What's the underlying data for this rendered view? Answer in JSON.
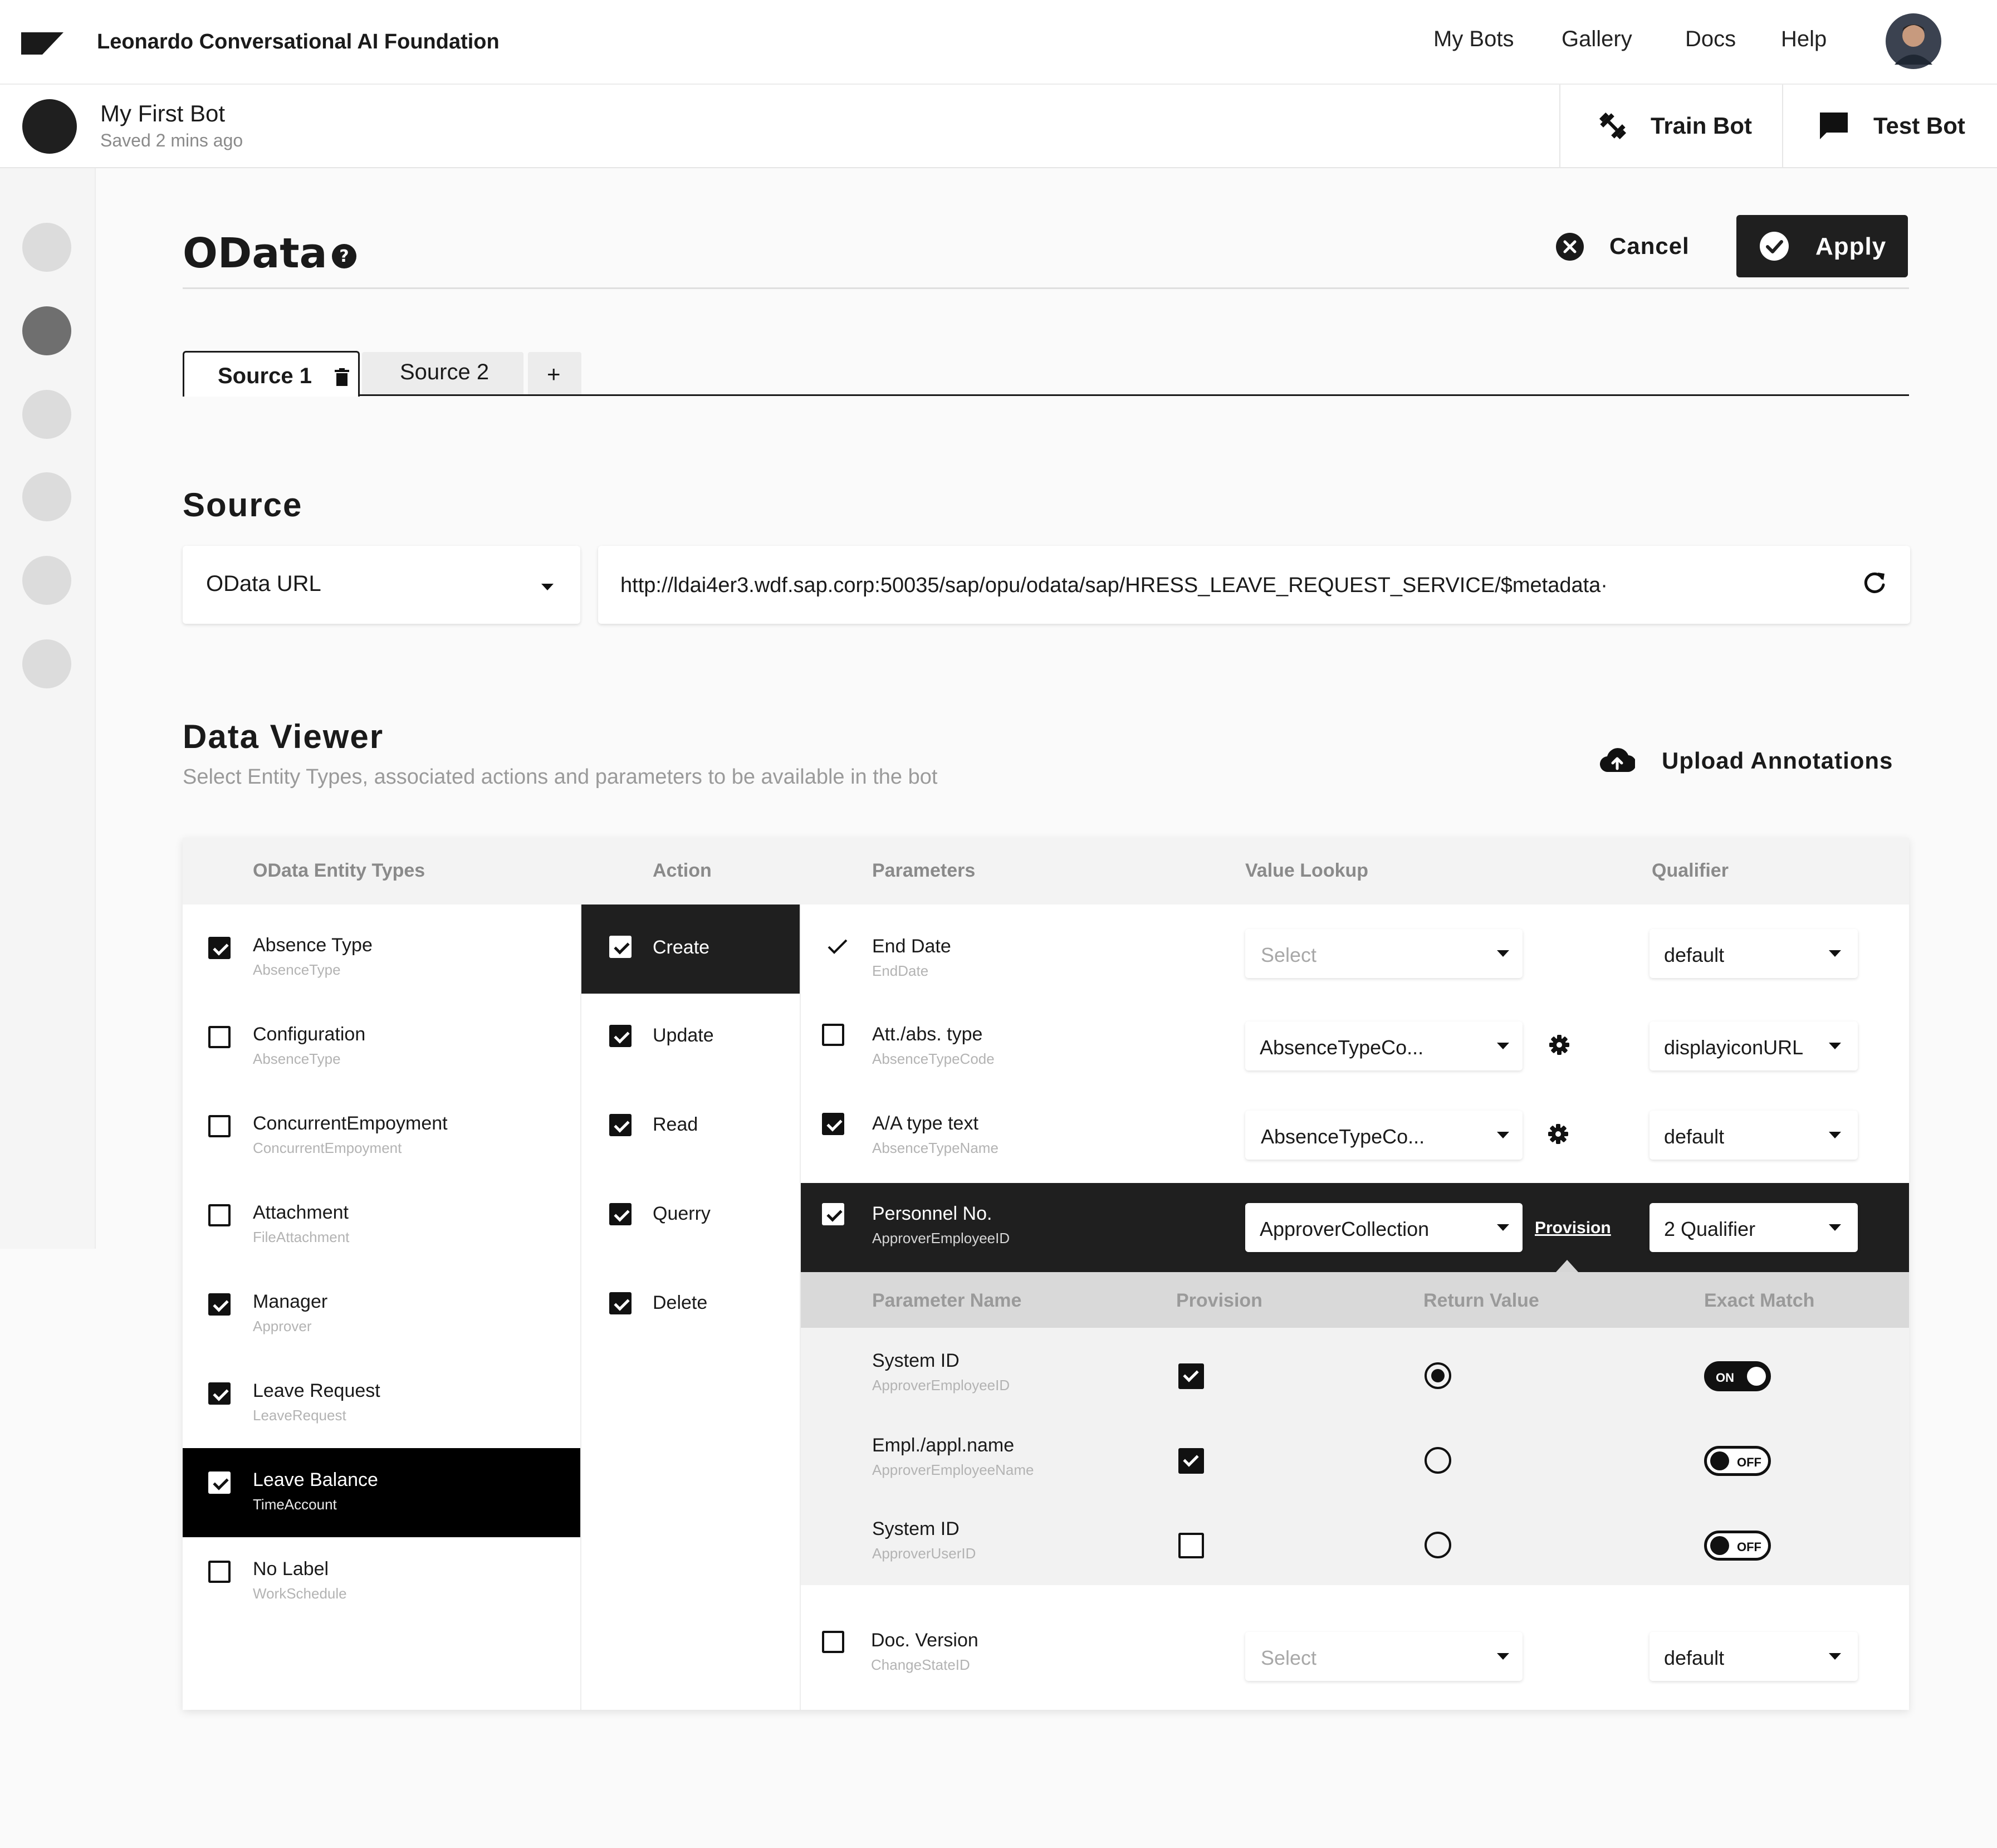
{
  "header": {
    "app_title": "Leonardo Conversational AI Foundation",
    "nav": [
      "My Bots",
      "Gallery",
      "Docs",
      "Help"
    ]
  },
  "bot": {
    "name": "My First Bot",
    "saved_status": "Saved 2 mins ago",
    "train_label": "Train Bot",
    "test_label": "Test Bot"
  },
  "page": {
    "title": "OData",
    "cancel_label": "Cancel",
    "apply_label": "Apply"
  },
  "tabs": [
    {
      "label": "Source 1",
      "active": true
    },
    {
      "label": "Source 2",
      "active": false
    }
  ],
  "add_tab_label": "+",
  "source": {
    "heading": "Source",
    "type_selected": "OData URL",
    "url": "http://ldai4er3.wdf.sap.corp:50035/sap/opu/odata/sap/HRESS_LEAVE_REQUEST_SERVICE/$metadata·"
  },
  "data_viewer": {
    "heading": "Data Viewer",
    "description": "Select Entity Types, associated actions and parameters to be available in the bot",
    "upload_label": "Upload Annotations",
    "columns": {
      "entity_types": "OData Entity Types",
      "action": "Action",
      "parameters": "Parameters",
      "value_lookup": "Value Lookup",
      "qualifier": "Qualifier"
    },
    "entities": [
      {
        "label": "Absence Type",
        "code": "AbsenceType",
        "checked": true
      },
      {
        "label": "Configuration",
        "code": "AbsenceType",
        "checked": false
      },
      {
        "label": "ConcurrentEmpoyment",
        "code": "ConcurrentEmpoyment",
        "checked": false
      },
      {
        "label": "Attachment",
        "code": "FileAttachment",
        "checked": false
      },
      {
        "label": "Manager",
        "code": "Approver",
        "checked": true
      },
      {
        "label": "Leave Request",
        "code": "LeaveRequest",
        "checked": true
      },
      {
        "label": "Leave Balance",
        "code": "TimeAccount",
        "checked": true,
        "selected": true
      },
      {
        "label": "No Label",
        "code": "WorkSchedule",
        "checked": false
      }
    ],
    "actions": [
      {
        "label": "Create",
        "checked": true,
        "selected": true
      },
      {
        "label": "Update",
        "checked": true
      },
      {
        "label": "Read",
        "checked": true
      },
      {
        "label": "Querry",
        "checked": true
      },
      {
        "label": "Delete",
        "checked": true
      }
    ],
    "parameters": [
      {
        "label": "End Date",
        "code": "EndDate",
        "lookup": "Select",
        "qualifier": "default"
      },
      {
        "label": "Att./abs. type",
        "code": "AbsenceTypeCode",
        "lookup": "AbsenceTypeCo...",
        "qualifier": "displayiconURL"
      },
      {
        "label": "A/A type text",
        "code": "AbsenceTypeName",
        "lookup": "AbsenceTypeCo...",
        "qualifier": "default"
      },
      {
        "label": "Personnel No.",
        "code": "ApproverEmployeeID",
        "lookup": "ApproverCollection",
        "qualifier": "2 Qualifier",
        "provision_link": "Provision"
      },
      {
        "label": "Doc. Version",
        "code": "ChangeStateID",
        "lookup": "Select",
        "qualifier": "default"
      }
    ],
    "provision_table": {
      "headers": [
        "Parameter Name",
        "Provision",
        "Return Value",
        "Exact Match"
      ],
      "rows": [
        {
          "label": "System ID",
          "code": "ApproverEmployeeID",
          "provision": true,
          "return_value": true,
          "exact_match": "ON"
        },
        {
          "label": "Empl./appl.name",
          "code": "ApproverEmployeeName",
          "provision": true,
          "return_value": false,
          "exact_match": "OFF"
        },
        {
          "label": "System ID",
          "code": "ApproverUserID",
          "provision": false,
          "return_value": false,
          "exact_match": "OFF"
        }
      ]
    }
  }
}
